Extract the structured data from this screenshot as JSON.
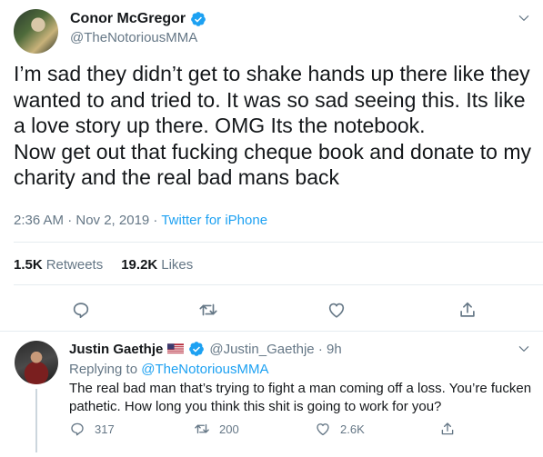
{
  "main_tweet": {
    "author": {
      "name": "Conor McGregor",
      "handle": "@TheNotoriousMMA",
      "verified": true
    },
    "text": "I’m sad they didn’t get to shake hands up there like they wanted to and tried to. It was so sad seeing this. Its like a love story up there. OMG Its the notebook.\nNow get out that fucking cheque book and donate to my charity and the real bad mans back",
    "timestamp": "2:36 AM · Nov 2, 2019",
    "separator": " · ",
    "source": "Twitter for iPhone",
    "stats": {
      "retweets_count": "1.5K",
      "retweets_label": "Retweets",
      "likes_count": "19.2K",
      "likes_label": "Likes"
    },
    "actions": [
      "reply-icon",
      "retweet-icon",
      "like-icon",
      "share-icon"
    ]
  },
  "reply_tweet": {
    "author": {
      "name": "Justin Gaethje",
      "flag": "us-flag-icon",
      "verified": true,
      "handle": "@Justin_Gaethje",
      "time": " · 9h"
    },
    "replying_prefix": "Replying to ",
    "replying_to": "@TheNotoriousMMA",
    "text": "The real bad man that’s trying to fight a man coming off a loss. You’re fucken pathetic. How long you think this shit is going to work for you?",
    "counts": {
      "replies": "317",
      "retweets": "200",
      "likes": "2.6K"
    }
  },
  "colors": {
    "accent": "#1da1f2",
    "text": "#14171a",
    "secondary": "#657786",
    "divider": "#e6ecf0",
    "thread": "#ccd6dd"
  }
}
